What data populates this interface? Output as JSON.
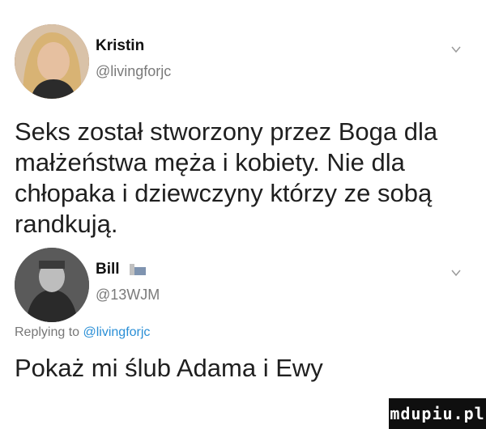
{
  "tweet": {
    "author_name": "Kristin",
    "author_handle": "@livingforjc",
    "text": "Seks został stworzony przez Boga dla małżeństwa męża i kobiety. Nie dla chłopaka i dziewczyny którzy ze sobą randkują."
  },
  "reply": {
    "author_name": "Bill",
    "author_handle": "@13WJM",
    "replying_prefix": "Replying to",
    "replying_handle": "@livingforjc",
    "text": "Pokaż mi ślub Adama i Ewy"
  },
  "watermark": {
    "text": "mdupiu.pl"
  },
  "icons": {
    "menu": "chevron-down-icon",
    "badge": "flag-emoji-icon"
  },
  "colors": {
    "link": "#2a8fd6",
    "handle": "#7a7a7a",
    "watermark_bg": "#0f0f0f"
  }
}
